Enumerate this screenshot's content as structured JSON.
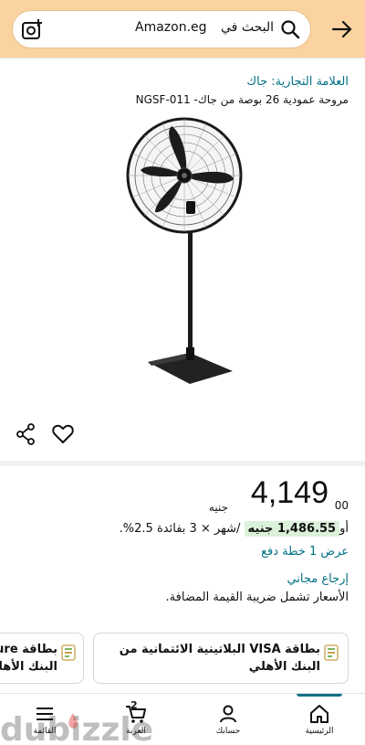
{
  "header": {
    "search_prefix": "البحث في",
    "search_store": "Amazon.eg",
    "camera_icon": "camera-search-icon",
    "search_icon": "search-icon",
    "nav_icon": "arrow-right-icon"
  },
  "product": {
    "brand": "العلامة التجارية: جاك",
    "title": "مروحة عمودية 26 بوصة من جاك- NGSF-011"
  },
  "price": {
    "currency": "جنيه",
    "whole": "4,149",
    "fraction": "00"
  },
  "installment": {
    "or": "أو",
    "amount": "1,486.55 جنيه",
    "detail": " /شهر × 3 بفائدة 2.5%."
  },
  "links": {
    "plan": "عرض 1 خطة دفع",
    "free_return": "إرجاع مجاني",
    "vat": "الأسعار تشمل ضريبة القيمة المضافة."
  },
  "cards": [
    {
      "label": "بطاقة VISA البلاتينية الائتمانية من البنك الأهلي"
    },
    {
      "label_line1": "بطاقة ure",
      "label_line2": "البنك الأهلي"
    }
  ],
  "bottom_nav": {
    "home": "الرئيسية",
    "account": "حسابك",
    "cart": "العربة",
    "cart_count": "2",
    "menu": "القائمة"
  },
  "colors": {
    "header_bg": "#fbd3a0",
    "link": "#007185",
    "installment_bg": "#dbf1d9"
  }
}
